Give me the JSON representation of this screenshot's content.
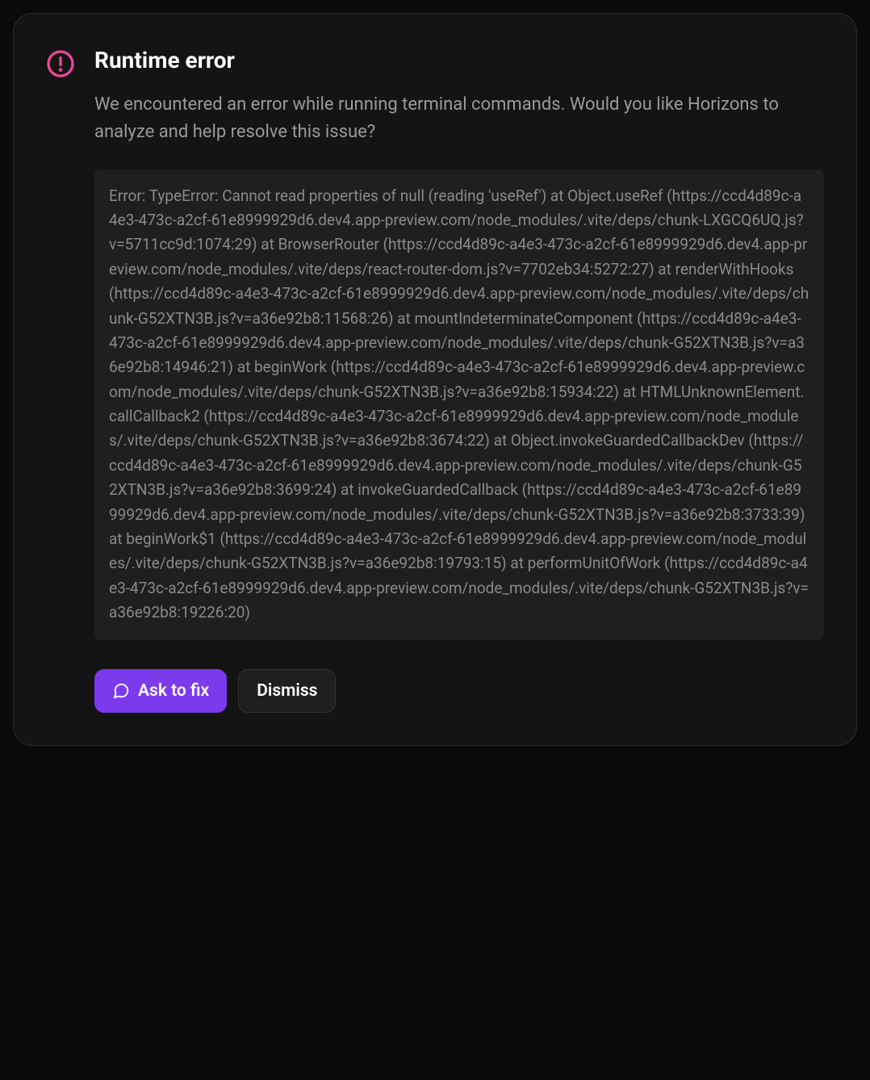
{
  "error": {
    "title": "Runtime error",
    "description": "We encountered an error while running terminal commands. Would you like Horizons to analyze and help resolve this issue?",
    "stack_trace": "Error: TypeError: Cannot read properties of null (reading 'useRef') at Object.useRef (https://ccd4d89c-a4e3-473c-a2cf-61e8999929d6.dev4.app-preview.com/node_modules/.vite/deps/chunk-LXGCQ6UQ.js?v=5711cc9d:1074:29) at BrowserRouter (https://ccd4d89c-a4e3-473c-a2cf-61e8999929d6.dev4.app-preview.com/node_modules/.vite/deps/react-router-dom.js?v=7702eb34:5272:27) at renderWithHooks (https://ccd4d89c-a4e3-473c-a2cf-61e8999929d6.dev4.app-preview.com/node_modules/.vite/deps/chunk-G52XTN3B.js?v=a36e92b8:11568:26) at mountIndeterminateComponent (https://ccd4d89c-a4e3-473c-a2cf-61e8999929d6.dev4.app-preview.com/node_modules/.vite/deps/chunk-G52XTN3B.js?v=a36e92b8:14946:21) at beginWork (https://ccd4d89c-a4e3-473c-a2cf-61e8999929d6.dev4.app-preview.com/node_modules/.vite/deps/chunk-G52XTN3B.js?v=a36e92b8:15934:22) at HTMLUnknownElement.callCallback2 (https://ccd4d89c-a4e3-473c-a2cf-61e8999929d6.dev4.app-preview.com/node_modules/.vite/deps/chunk-G52XTN3B.js?v=a36e92b8:3674:22) at Object.invokeGuardedCallbackDev (https://ccd4d89c-a4e3-473c-a2cf-61e8999929d6.dev4.app-preview.com/node_modules/.vite/deps/chunk-G52XTN3B.js?v=a36e92b8:3699:24) at invokeGuardedCallback (https://ccd4d89c-a4e3-473c-a2cf-61e8999929d6.dev4.app-preview.com/node_modules/.vite/deps/chunk-G52XTN3B.js?v=a36e92b8:3733:39) at beginWork$1 (https://ccd4d89c-a4e3-473c-a2cf-61e8999929d6.dev4.app-preview.com/node_modules/.vite/deps/chunk-G52XTN3B.js?v=a36e92b8:19793:15) at performUnitOfWork (https://ccd4d89c-a4e3-473c-a2cf-61e8999929d6.dev4.app-preview.com/node_modules/.vite/deps/chunk-G52XTN3B.js?v=a36e92b8:19226:20)"
  },
  "buttons": {
    "ask_to_fix_label": "Ask to fix",
    "dismiss_label": "Dismiss"
  },
  "colors": {
    "error_icon": "#ec4899",
    "primary_button": "#7c3aed",
    "panel_bg": "#141414",
    "trace_bg": "#1f1f1f"
  }
}
